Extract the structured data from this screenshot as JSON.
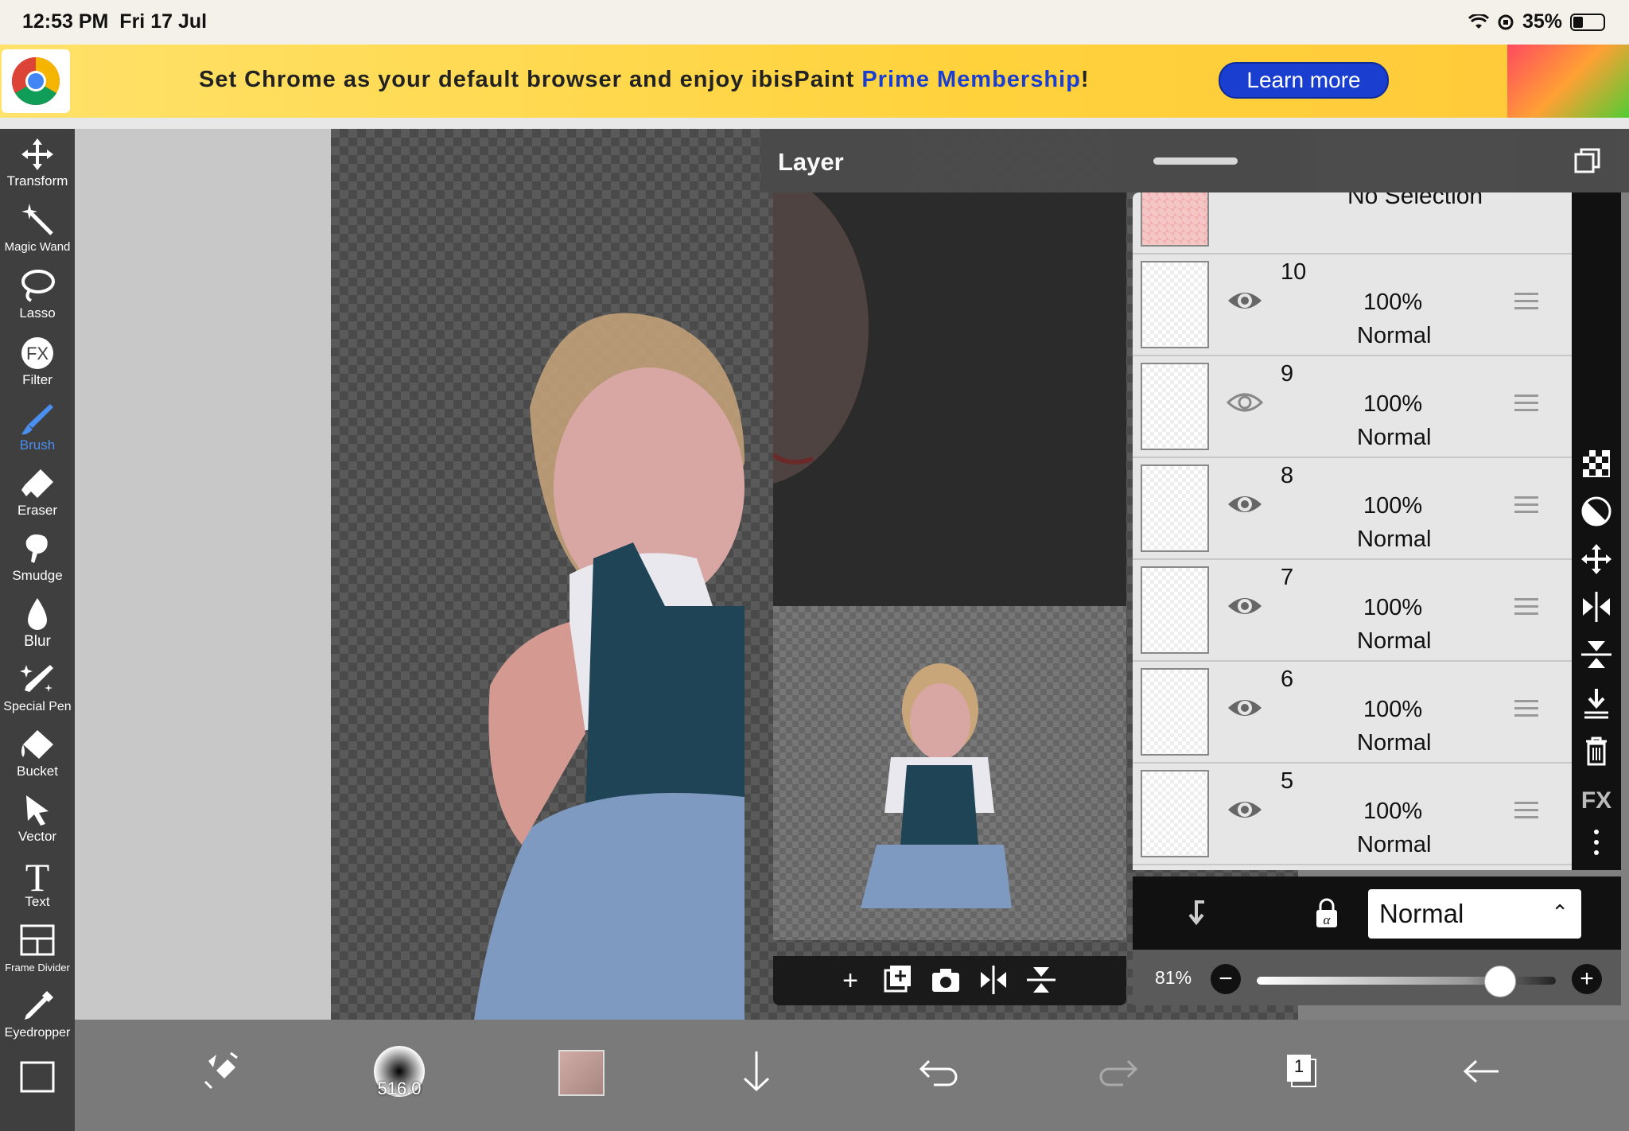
{
  "status": {
    "time": "12:53 PM",
    "date": "Fri 17 Jul",
    "battery": "35%"
  },
  "banner": {
    "text_before": "Set Chrome as your default browser and enjoy ibisPaint ",
    "highlight": "Prime Membership",
    "text_after": "!",
    "button": "Learn more"
  },
  "tools": [
    {
      "label": "Transform",
      "icon": "move-arrows-icon"
    },
    {
      "label": "Magic Wand",
      "icon": "magic-wand-icon"
    },
    {
      "label": "Lasso",
      "icon": "lasso-icon"
    },
    {
      "label": "Filter",
      "icon": "fx-filter-icon"
    },
    {
      "label": "Brush",
      "icon": "brush-icon",
      "active": true
    },
    {
      "label": "Eraser",
      "icon": "eraser-icon"
    },
    {
      "label": "Smudge",
      "icon": "smudge-icon"
    },
    {
      "label": "Blur",
      "icon": "droplet-icon"
    },
    {
      "label": "Special Pen",
      "icon": "special-pen-icon"
    },
    {
      "label": "Bucket",
      "icon": "bucket-icon"
    },
    {
      "label": "Vector",
      "icon": "cursor-arrow-icon"
    },
    {
      "label": "Text",
      "icon": "text-t-icon"
    },
    {
      "label": "Frame Divider",
      "icon": "frame-divider-icon"
    },
    {
      "label": "Eyedropper",
      "icon": "eyedropper-icon"
    }
  ],
  "layer_panel": {
    "title": "Layer",
    "no_selection": "No Selection",
    "layers": [
      {
        "num": "10",
        "opacity": "100%",
        "blend": "Normal"
      },
      {
        "num": "9",
        "opacity": "100%",
        "blend": "Normal"
      },
      {
        "num": "8",
        "opacity": "100%",
        "blend": "Normal"
      },
      {
        "num": "7",
        "opacity": "100%",
        "blend": "Normal"
      },
      {
        "num": "6",
        "opacity": "100%",
        "blend": "Normal"
      },
      {
        "num": "5",
        "opacity": "100%",
        "blend": "Normal"
      }
    ],
    "blend_mode": "Normal",
    "opacity_value": "81%",
    "opacity_level": 0.81
  },
  "bottom": {
    "brush_size": "516.0",
    "layer_count": "1"
  },
  "colors": {
    "accent": "#4a8ef0",
    "toolbar_bg": "#3f3f3f",
    "panel_bg": "#e6e6e6",
    "brush_color": "#c4a09a"
  }
}
